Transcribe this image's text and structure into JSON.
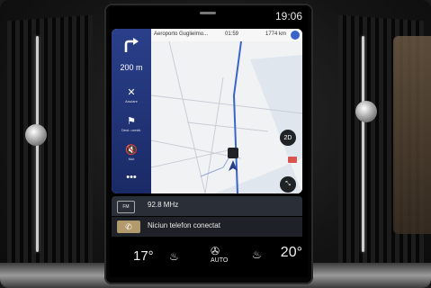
{
  "status": {
    "time": "19:06"
  },
  "nav": {
    "next_turn_distance": "200 m",
    "buttons": [
      {
        "icon": "close-icon",
        "glyph": "✕",
        "label": "Anulare"
      },
      {
        "icon": "flag-icon",
        "glyph": "⚑",
        "label": "Dest. următ."
      },
      {
        "icon": "mute-icon",
        "glyph": "🔇",
        "label": "Mut"
      },
      {
        "icon": "more-icon",
        "glyph": "•••",
        "label": ""
      }
    ],
    "street": "Aeroporto Guglielmo...",
    "eta": "01:59",
    "remaining": "1774 km",
    "view_mode": "2D"
  },
  "radio": {
    "source_icon": "FM",
    "frequency": "92.8 MHz"
  },
  "phone": {
    "status": "Niciun telefon conectat"
  },
  "climate": {
    "temp_left": "17°",
    "temp_right": "20°",
    "auto_label": "AUTO"
  },
  "colors": {
    "nav_panel": "#2a3f8a",
    "map_bg": "#f0f2f4",
    "route": "#3a64c8"
  }
}
